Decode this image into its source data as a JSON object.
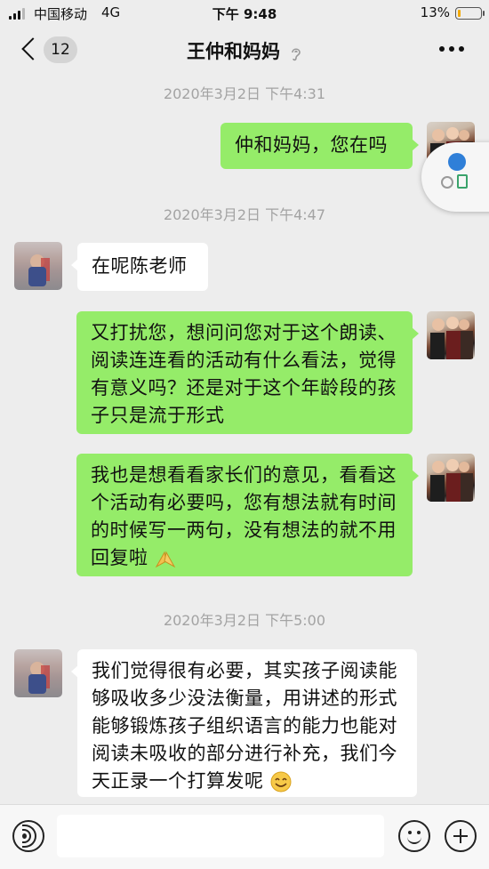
{
  "status_bar": {
    "carrier": "中国移动",
    "network": "4G",
    "time": "下午 9:48",
    "battery_percent": "13%",
    "battery_level": 0.13,
    "battery_color": "#f2a900"
  },
  "header": {
    "back_icon": "chevron-left-icon",
    "unread_count": "12",
    "title": "王仲和妈妈",
    "earpiece_icon": "earpiece-icon",
    "more_icon": "more-dots-icon"
  },
  "messages": [
    {
      "type": "time",
      "text": "2020年3月2日 下午4:31"
    },
    {
      "type": "message",
      "sender": "me",
      "text": "仲和妈妈，您在吗"
    },
    {
      "type": "time",
      "text": "2020年3月2日 下午4:47"
    },
    {
      "type": "message",
      "sender": "other",
      "text": "在呢陈老师"
    },
    {
      "type": "message",
      "sender": "me",
      "text": "又打扰您，想问问您对于这个朗读、阅读连连看的活动有什么看法，觉得有意义吗？还是对于这个年龄段的孩子只是流于形式"
    },
    {
      "type": "message",
      "sender": "me",
      "text": "我也是想看看家长们的意见，看看这个活动有必要吗，您有想法就有时间的时候写一两句，没有想法的就不用回复啦",
      "emoji": "praying-hands-emoji"
    },
    {
      "type": "time",
      "text": "2020年3月2日 下午5:00"
    },
    {
      "type": "message",
      "sender": "other",
      "text": "我们觉得很有必要，其实孩子阅读能够吸收多少没法衡量，用讲述的形式能够锻炼孩子组织语言的能力也能对阅读未吸收的部分进行补充，我们今天正录一个打算发呢",
      "emoji": "smiling-face-emoji"
    }
  ],
  "colors": {
    "background": "#ededed",
    "my_bubble": "#95ec69",
    "other_bubble": "#ffffff",
    "timestamp": "#a3a3a3"
  },
  "input_bar": {
    "voice_icon": "voice-icon",
    "text_value": "",
    "emoji_icon": "emoji-icon",
    "plus_icon": "plus-icon"
  },
  "floating_widget": {
    "icons": [
      "avatar-dot-icon",
      "link-icon",
      "document-icon"
    ]
  }
}
